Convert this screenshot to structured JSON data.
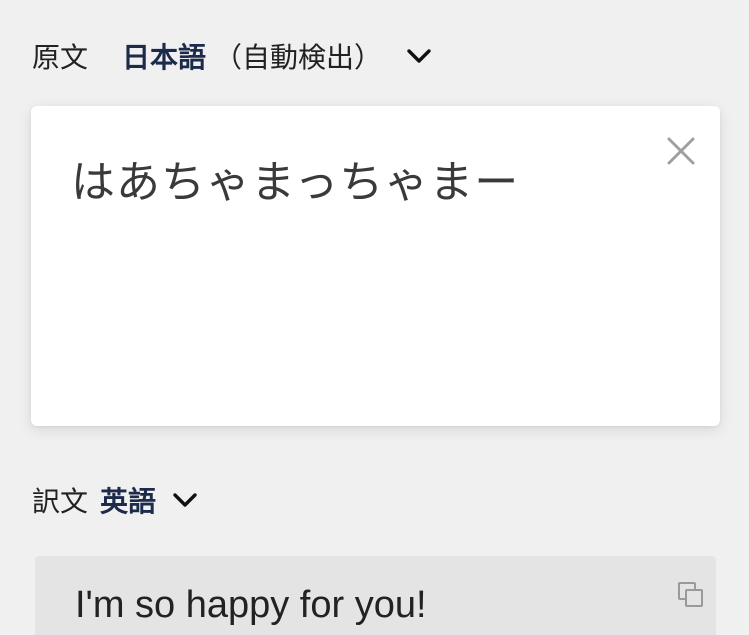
{
  "source": {
    "label": "原文",
    "language": "日本語",
    "detect_note": "（自動検出）",
    "chevron_icon": "chevron-down-icon",
    "text": "はあちゃまっちゃまー",
    "clear_icon": "close-icon"
  },
  "target": {
    "label": "訳文",
    "language": "英語",
    "chevron_icon": "chevron-down-icon",
    "text": "I'm so happy for you!",
    "copy_icon": "copy-icon"
  },
  "colors": {
    "background": "#f0f0f0",
    "card": "#ffffff",
    "result_card": "#e4e4e4",
    "language_accent": "#1c2b4a",
    "icon_gray": "#9a9a9a"
  }
}
